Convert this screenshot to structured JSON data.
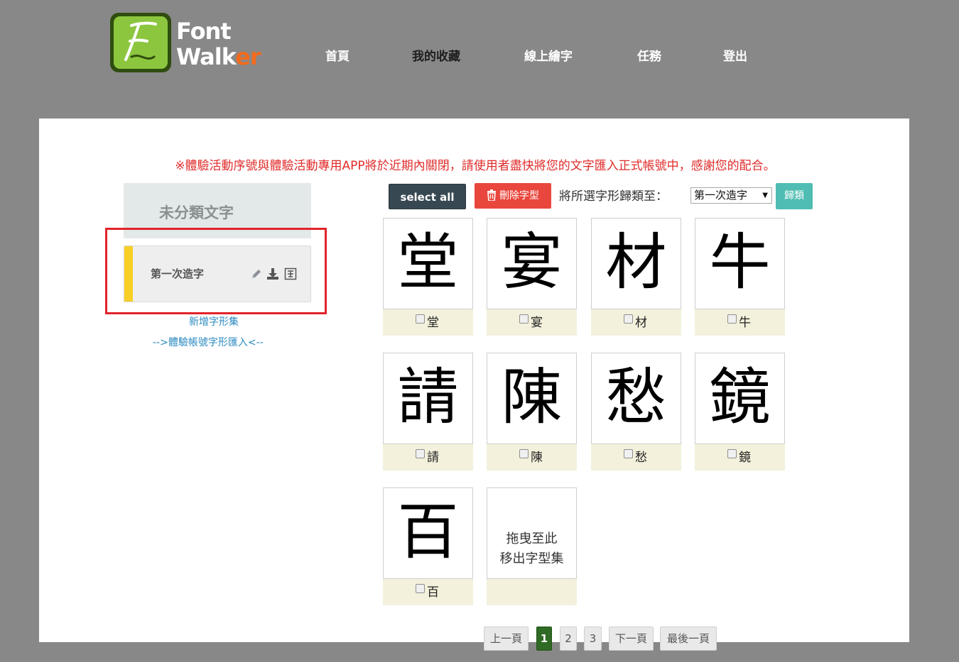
{
  "logo": {
    "line1": "Font",
    "line2_a": "Walk",
    "line2_b": "er",
    "brand_green": "#8cc63f",
    "accent": "#f26b1d"
  },
  "nav": {
    "home": "首頁",
    "favorites": "我的收藏",
    "draw": "線上繪字",
    "tasks": "任務",
    "logout": "登出"
  },
  "notice": "※體驗活動序號與體驗活動專用APP將於近期內關閉，請使用者盡快將您的文字匯入正式帳號中，感謝您的配合。",
  "sidebar": {
    "header": "未分類文字",
    "item_label": "第一次造字",
    "item_icons": [
      "pencil-icon",
      "download-icon",
      "font-image-icon"
    ],
    "add_set_link": "新增字形集",
    "import_link": "-->體驗帳號字形匯入<--"
  },
  "toolbar": {
    "select_all": "select all",
    "delete": "刪除字型",
    "assign_label": "將所選字形歸類至：",
    "assign_value": "第一次造字",
    "classify": "歸類"
  },
  "glyphs": [
    {
      "char": "堂",
      "label": "堂"
    },
    {
      "char": "宴",
      "label": "宴"
    },
    {
      "char": "材",
      "label": "材"
    },
    {
      "char": "牛",
      "label": "牛"
    },
    {
      "char": "請",
      "label": "請"
    },
    {
      "char": "陳",
      "label": "陳"
    },
    {
      "char": "愁",
      "label": "愁"
    },
    {
      "char": "鏡",
      "label": "鏡"
    },
    {
      "char": "百",
      "label": "百"
    }
  ],
  "drop_zone": {
    "line1": "拖曳至此",
    "line2": "移出字型集"
  },
  "pagination": {
    "prev": "上一頁",
    "pages": [
      "1",
      "2",
      "3"
    ],
    "current": "1",
    "next": "下一頁",
    "last": "最後一頁"
  },
  "colors": {
    "notice": "#e02b2b",
    "select_all_bg": "#374852",
    "delete_bg": "#e9473d",
    "classify_bg": "#4fbdb3",
    "highlight": "#e1242a",
    "page_active": "#2f6b24",
    "item_accent": "#f7cf25"
  }
}
